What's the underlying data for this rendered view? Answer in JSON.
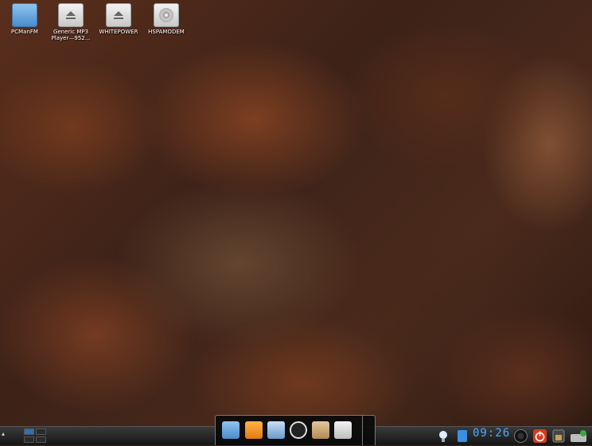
{
  "desktop": {
    "icons": [
      {
        "label": "PCManFM",
        "icon": "folder-icon"
      },
      {
        "label": "Generic MP3 Player—952...",
        "icon": "drive-icon"
      },
      {
        "label": "WHITEPOWER",
        "icon": "drive-icon"
      },
      {
        "label": "HSPAMODEM",
        "icon": "disc-icon"
      }
    ]
  },
  "taskbar": {
    "menu_glyph": "▴",
    "dock_items": [
      "folder-icon",
      "browser-icon",
      "photo-icon",
      "amarok-icon",
      "package-icon",
      "drive-icon"
    ],
    "clock": "09:26"
  }
}
